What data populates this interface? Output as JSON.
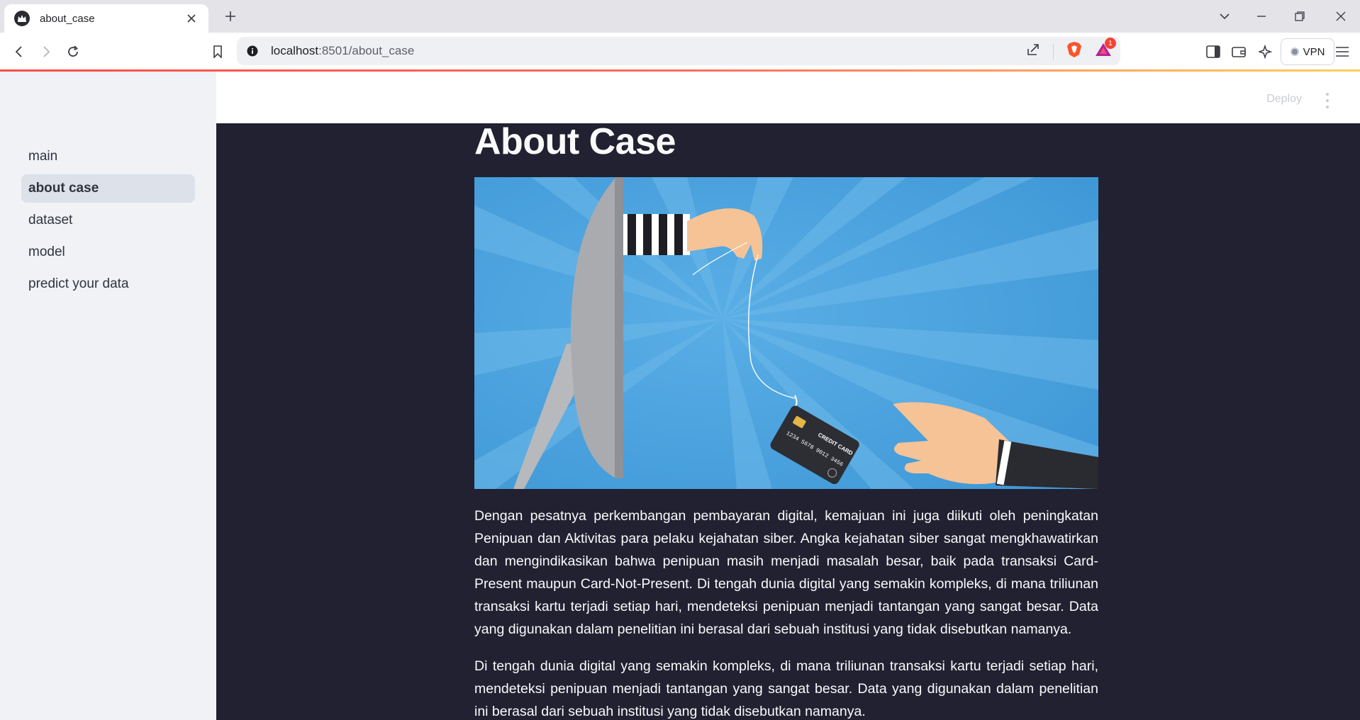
{
  "browser": {
    "tab_title": "about_case",
    "url_host": "localhost",
    "url_path": ":8501/about_case",
    "vpn_label": "VPN",
    "notification_count": "1"
  },
  "header": {
    "deploy_label": "Deploy"
  },
  "sidebar": {
    "items": [
      {
        "label": "main"
      },
      {
        "label": "about case"
      },
      {
        "label": "dataset"
      },
      {
        "label": "model"
      },
      {
        "label": "predict your data"
      }
    ],
    "active": "about case"
  },
  "page": {
    "title": "About Case",
    "illustration_text": {
      "card_brand": "CREDIT CARD",
      "card_number": "1234 5678 9012 3456"
    },
    "paragraphs": [
      "Dengan pesatnya perkembangan pembayaran digital, kemajuan ini juga diikuti oleh peningkatan Penipuan dan Aktivitas para pelaku kejahatan siber. Angka kejahatan siber sangat mengkhawatirkan dan mengindikasikan bahwa penipuan masih menjadi masalah besar, baik pada transaksi Card-Present maupun Card-Not-Present. Di tengah dunia digital yang semakin kompleks, di mana triliunan transaksi kartu terjadi setiap hari, mendeteksi penipuan menjadi tantangan yang sangat besar. Data yang digunakan dalam penelitian ini berasal dari sebuah institusi yang tidak disebutkan namanya.",
      "Di tengah dunia digital yang semakin kompleks, di mana triliunan transaksi kartu terjadi setiap hari, mendeteksi penipuan menjadi tantangan yang sangat besar. Data yang digunakan dalam penelitian ini berasal dari sebuah institusi yang tidak disebutkan namanya."
    ]
  },
  "colors": {
    "main_bg": "#212132",
    "sidebar_bg": "#f0f2f6",
    "sidebar_active_bg": "#dde1e9",
    "hero_sky": "#4ea5df"
  }
}
